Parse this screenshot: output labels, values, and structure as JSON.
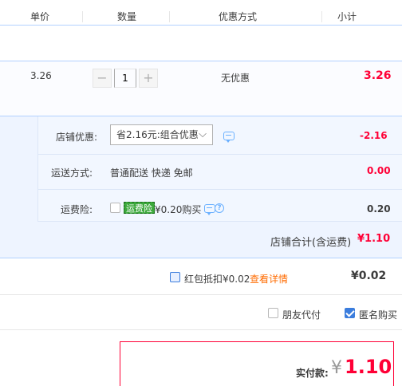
{
  "header": {
    "col_unit_price": "单价",
    "col_quantity": "数量",
    "col_discount": "优惠方式",
    "col_subtotal": "小计"
  },
  "item": {
    "unit_price": "3.26",
    "quantity": "1",
    "decrement_label": "−",
    "increment_label": "+",
    "discount": "无优惠",
    "subtotal": "3.26"
  },
  "store": {
    "promo_label": "店铺优惠:",
    "promo_selected": "省2.16元:组合优惠",
    "promo_amount": "-2.16",
    "shipping_label": "运送方式:",
    "shipping_value": "普通配送 快递 免邮",
    "shipping_amount": "0.00",
    "insurance_label": "运费险:",
    "insurance_tag": "运费险",
    "insurance_text": "¥0.20购买",
    "insurance_amount": "0.20",
    "total_label": "店铺合计(含运费)",
    "total_value": "¥1.10"
  },
  "redpacket": {
    "label": "红包抵扣¥0.02",
    "link": "查看详情",
    "value": "¥0.02"
  },
  "options": {
    "friend_pay": "朋友代付",
    "anonymous": "匿名购买",
    "anonymous_checked": true
  },
  "payment": {
    "label": "实付款:",
    "currency": "¥",
    "amount": "1.10"
  },
  "colors": {
    "accent_red": "#ff0036",
    "accent_blue": "#3b7ddd",
    "panel_blue": "#eef4ff",
    "link_orange": "#ff6b00"
  },
  "icons": [
    "chat-icon",
    "help-icon",
    "chevron-down-icon",
    "checkbox-icon"
  ]
}
